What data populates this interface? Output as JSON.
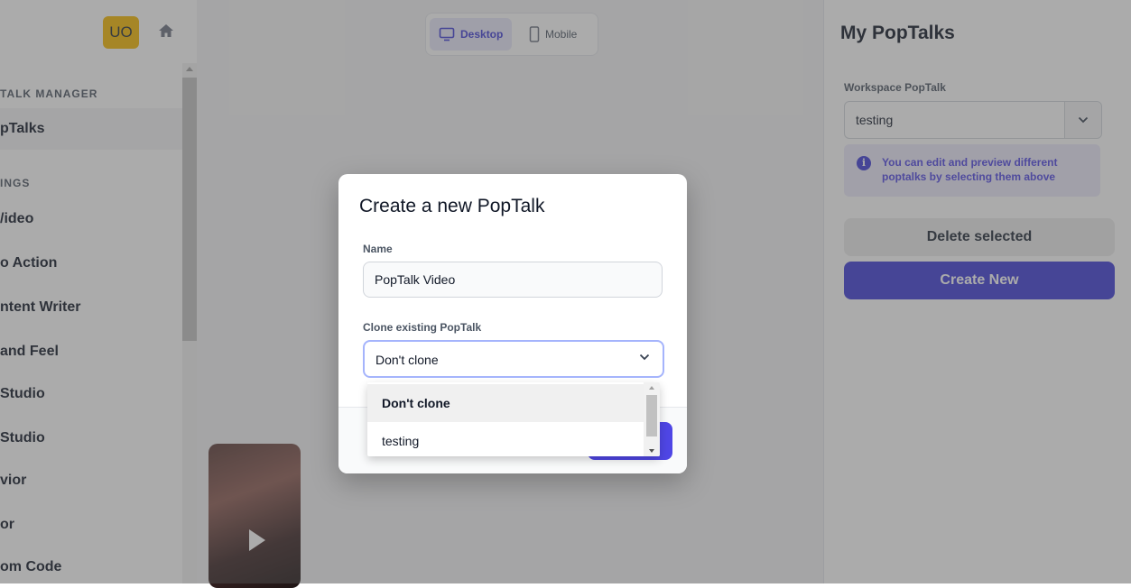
{
  "sidebar": {
    "avatar_initials": "UO",
    "sections": [
      {
        "label": "TALK MANAGER"
      },
      {
        "label": "INGS"
      }
    ],
    "items": [
      {
        "label": "pTalks"
      },
      {
        "label": "/ideo"
      },
      {
        "label": "o Action"
      },
      {
        "label": "ntent Writer"
      },
      {
        "label": "and Feel"
      },
      {
        "label": " Studio"
      },
      {
        "label": "Studio"
      },
      {
        "label": "vior"
      },
      {
        "label": "or"
      },
      {
        "label": "om Code"
      }
    ]
  },
  "preview": {
    "desktop_label": "Desktop",
    "mobile_label": "Mobile"
  },
  "right_panel": {
    "title": "My PopTalks",
    "workspace_label": "Workspace PopTalk",
    "selected_poptalk": "testing",
    "info_text": "You can edit and preview different poptalks by selecting them above",
    "delete_label": "Delete selected",
    "create_label": "Create New"
  },
  "modal": {
    "title": "Create a new PopTalk",
    "name_label": "Name",
    "name_value": "PopTalk Video",
    "clone_label": "Clone existing PopTalk",
    "clone_value": "Don't clone",
    "options": [
      {
        "label": "Don't clone",
        "selected": true
      },
      {
        "label": "testing",
        "selected": false
      }
    ]
  },
  "colors": {
    "accent": "#3e3dd6",
    "avatar": "#f5b800"
  }
}
